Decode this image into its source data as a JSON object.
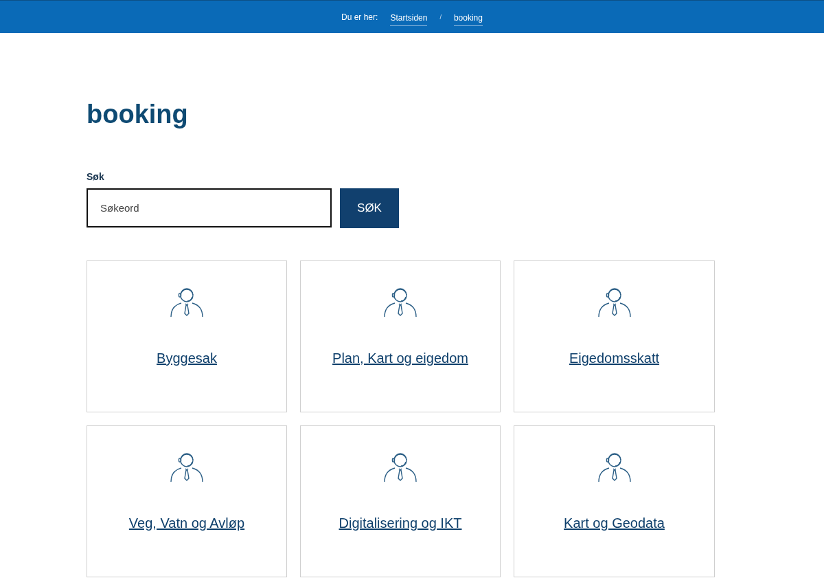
{
  "breadcrumb": {
    "label": "Du er her:",
    "items": [
      {
        "text": "Startsiden"
      },
      {
        "text": "booking"
      }
    ],
    "separator": "/"
  },
  "heading": "booking",
  "search": {
    "label": "Søk",
    "placeholder": "Søkeord",
    "button": "SØK"
  },
  "cards": [
    {
      "title": "Byggesak"
    },
    {
      "title": "Plan, Kart og eigedom"
    },
    {
      "title": "Eigedomsskatt"
    },
    {
      "title": "Veg, Vatn og Avløp"
    },
    {
      "title": "Digitalisering og IKT"
    },
    {
      "title": "Kart og Geodata"
    }
  ]
}
